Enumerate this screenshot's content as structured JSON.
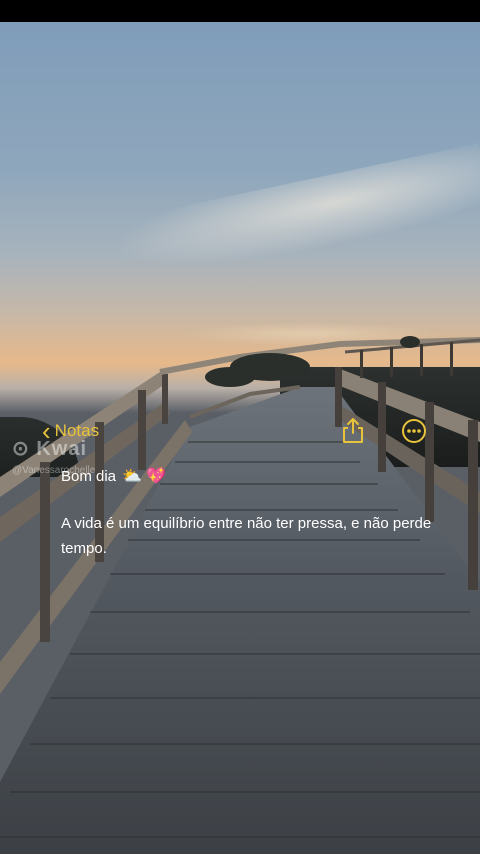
{
  "watermark": {
    "brand": "Kwai",
    "user": "@Vanessarochelle"
  },
  "nav": {
    "back_label": "Notas"
  },
  "note": {
    "greeting": "Bom dia",
    "greeting_emojis": "⛅ 💖",
    "body": "A vida é um equilíbrio entre não ter pressa, e não perde tempo."
  },
  "colors": {
    "accent": "#e8c33c",
    "text": "#ffffff"
  },
  "icons": {
    "back": "chevron-left-icon",
    "share": "share-icon",
    "more": "more-options-icon"
  }
}
